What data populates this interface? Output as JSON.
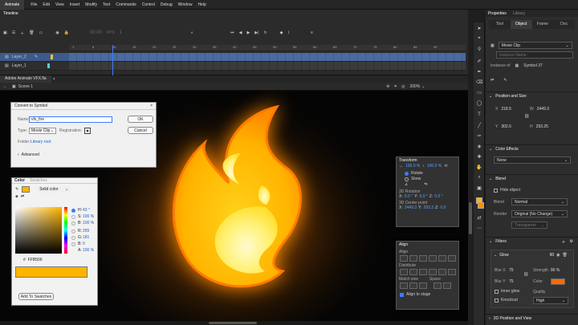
{
  "menubar": {
    "app_name": "Animate",
    "items": [
      "File",
      "Edit",
      "View",
      "Insert",
      "Modify",
      "Text",
      "Commands",
      "Control",
      "Debug",
      "Window",
      "Help"
    ]
  },
  "timeline": {
    "tab": "Timeline",
    "fps": "00.00",
    "fps_unit": "FPS",
    "frame": "1",
    "ruler_ticks": [
      "1",
      "5",
      "10",
      "15",
      "20",
      "25",
      "30",
      "35",
      "40",
      "45",
      "50",
      "55",
      "60",
      "65",
      "70",
      "75",
      "80",
      "85",
      "90"
    ],
    "layers": [
      {
        "name": "Layer_2",
        "selected": true
      },
      {
        "name": "Layer_1",
        "selected": false
      }
    ]
  },
  "document": {
    "tab": "Adobe Animate VFX.fla",
    "scene": "Scene 1",
    "zoom": "200%"
  },
  "convert_dialog": {
    "title": "Convert to Symbol",
    "name_label": "Name:",
    "name_value": "vfx_fire",
    "type_label": "Type:",
    "type_value": "Movie Clip",
    "registration_label": "Registration:",
    "folder_label": "Folder:",
    "folder_value": "Library root",
    "advanced": "Advanced",
    "ok": "OK",
    "cancel": "Cancel"
  },
  "color_panel": {
    "tabs": [
      "Color",
      "Swatches"
    ],
    "mode": "Solid color",
    "fields": [
      {
        "label": "H:",
        "value": "43 °"
      },
      {
        "label": "S:",
        "value": "100 %"
      },
      {
        "label": "B:",
        "value": "100 %"
      },
      {
        "label": "R:",
        "value": "255"
      },
      {
        "label": "G:",
        "value": "181"
      },
      {
        "label": "B:",
        "value": "0"
      },
      {
        "label": "A:",
        "value": "100 %"
      }
    ],
    "hex": "FFB500",
    "add_swatch": "Add To Swatches",
    "swatch_color": "#FFB500"
  },
  "transform_panel": {
    "title": "Transform",
    "scale_w": "100.0 %",
    "scale_h": "100.0 %",
    "rotate": "Rotate",
    "skew": "Skew",
    "rotation_3d": "3D Rotation",
    "center_3d": "3D Center point",
    "x_label": "X:",
    "y_label": "Y:",
    "z_label": "Z:",
    "rot_x": "0.0 °",
    "rot_y": "0.0 °",
    "rot_z": "0.0 °",
    "cx": "2449.3",
    "cy": "293.3",
    "cz": "0.0"
  },
  "align_panel": {
    "title": "Align",
    "align": "Align",
    "distribute": "Distribute",
    "match_size": "Match size",
    "space": "Space",
    "align_to_stage": "Align to stage"
  },
  "properties": {
    "header": "Properties",
    "header2": "Library",
    "tabs": [
      "Tool",
      "Object",
      "Frame",
      "Doc"
    ],
    "active_tab": "Object",
    "symbol_type": "Movie Clip",
    "instance_name": "Instance Name",
    "instance_of_label": "Instance of",
    "instance_of": "Symbol 37",
    "position_size": "Position and Size",
    "x_label": "X",
    "y_label": "Y",
    "w_label": "W",
    "h_label": "H",
    "x": "218.5",
    "y": "302.5",
    "w": "2449.3",
    "h": "293.25",
    "color_effects": "Color Effects",
    "color_effect_value": "None",
    "blend": "Blend",
    "hide_object": "Hide object",
    "blend_label": "Blend",
    "blend_value": "Normal",
    "render_label": "Render",
    "render_value": "Original (No Change)",
    "transparent_value": "Transparent",
    "filters": "Filters",
    "glow": "Glow",
    "glow_amount": "90",
    "blur_x_label": "Blur X",
    "blur_y_label": "Blur Y",
    "blur_x": "75",
    "blur_y": "75",
    "strength_label": "Strength",
    "strength": "90 %",
    "color_label": "Color",
    "inner_glow": "Inner glow",
    "knockout": "Knockout",
    "quality_label": "Quality",
    "quality": "High",
    "position_3d": "3D Position and View",
    "glow_color": "#FF6A00"
  }
}
